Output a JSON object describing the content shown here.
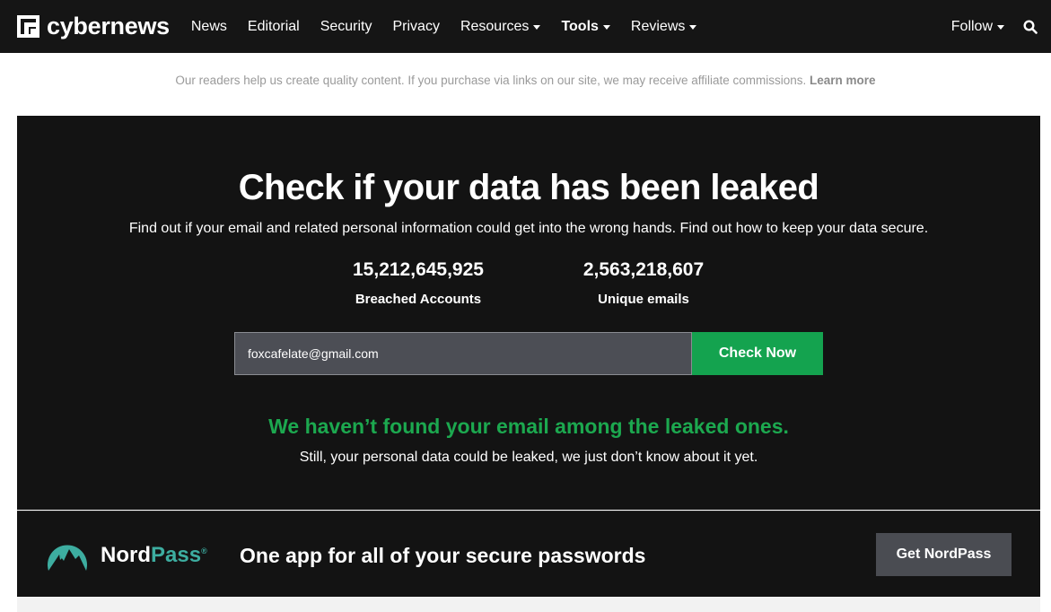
{
  "brand": {
    "name": "cybernews"
  },
  "nav": {
    "items": [
      {
        "label": "News",
        "dropdown": false,
        "bold": false
      },
      {
        "label": "Editorial",
        "dropdown": false,
        "bold": false
      },
      {
        "label": "Security",
        "dropdown": false,
        "bold": false
      },
      {
        "label": "Privacy",
        "dropdown": false,
        "bold": false
      },
      {
        "label": "Resources",
        "dropdown": true,
        "bold": false
      },
      {
        "label": "Tools",
        "dropdown": true,
        "bold": true
      },
      {
        "label": "Reviews",
        "dropdown": true,
        "bold": false
      }
    ],
    "follow_label": "Follow",
    "search_icon": "search-icon"
  },
  "disclaimer": {
    "text": "Our readers help us create quality content. If you purchase via links on our site, we may receive affiliate commissions.",
    "link": "Learn more"
  },
  "hero": {
    "title": "Check if your data has been leaked",
    "subtitle": "Find out if your email and related personal information could get into the wrong hands. Find out how to keep your data secure.",
    "stats": [
      {
        "value": "15,212,645,925",
        "label": "Breached Accounts"
      },
      {
        "value": "2,563,218,607",
        "label": "Unique emails"
      }
    ],
    "email_value": "foxcafelate@gmail.com",
    "check_button": "Check Now",
    "result_title": "We haven’t found your email among the leaked ones.",
    "result_sub": "Still, your personal data could be leaked, we just don’t know about it yet."
  },
  "banner": {
    "logo_text_primary": "Nord",
    "logo_text_accent": "Pass",
    "logo_reg": "®",
    "tagline": "One app for all of your secure passwords",
    "button": "Get NordPass"
  },
  "colors": {
    "nav_bg": "#151515",
    "hero_bg": "#131313",
    "accent_green": "#14a34f",
    "result_green": "#1ca84f",
    "nordpass_teal": "#3dada0"
  }
}
